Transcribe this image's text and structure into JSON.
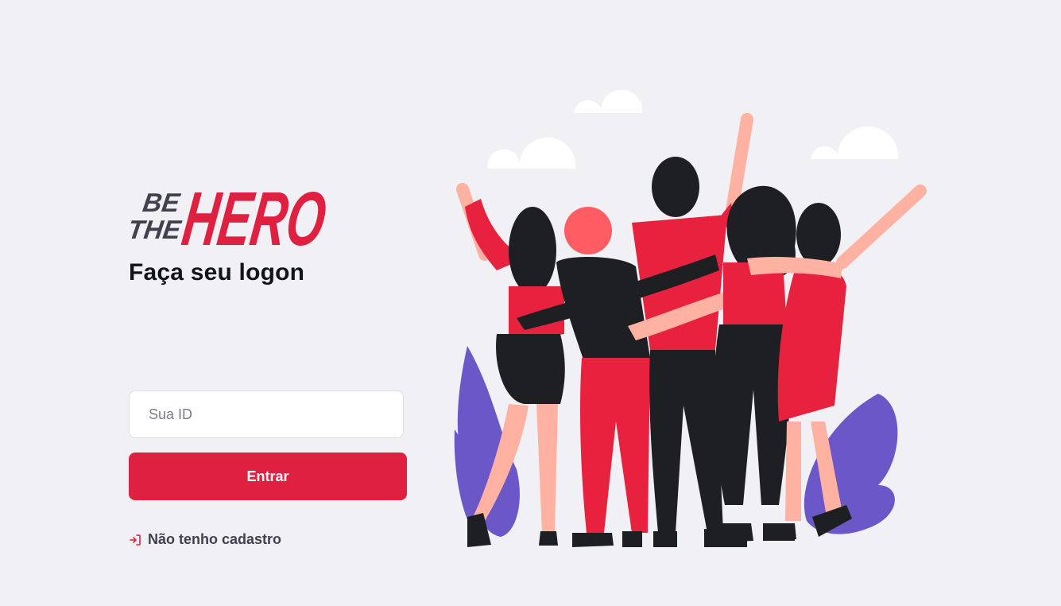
{
  "logo": {
    "be": "BE",
    "the": "THE",
    "hero": "HERO",
    "colors": {
      "dark": "#41414d",
      "red": "#e02041"
    }
  },
  "login": {
    "title": "Faça seu logon",
    "id_placeholder": "Sua ID",
    "id_value": "",
    "submit_label": "Entrar",
    "register_link": "Não tenho cadastro",
    "register_icon": "log-in-icon"
  },
  "illustration": {
    "name": "heroes-illustration",
    "colors": {
      "red": "#e8213f",
      "dark": "#1e1f23",
      "skin": "#ffb2a1",
      "leaf": "#6b57c8",
      "cloud": "#ffffff"
    }
  },
  "theme": {
    "background": "#f0f0f5",
    "accent": "#e02041",
    "text": "#13131a"
  }
}
